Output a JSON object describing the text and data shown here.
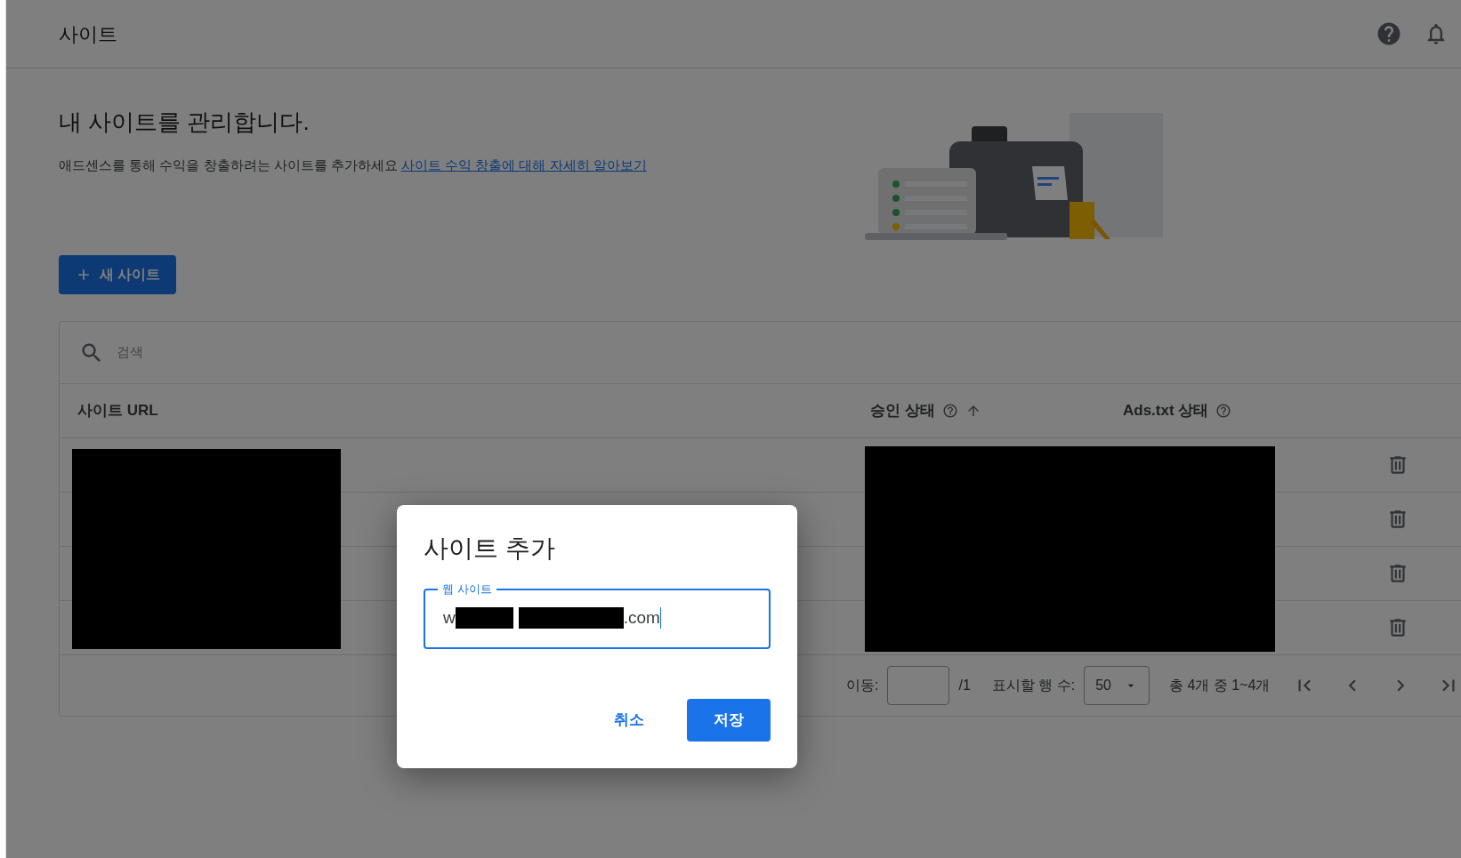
{
  "header": {
    "title": "사이트"
  },
  "intro": {
    "heading": "내 사이트를 관리합니다.",
    "description": "애드센스를 통해 수익을 창출하려는 사이트를 추가하세요",
    "link": "사이트 수익 창출에 대해 자세히 알아보기"
  },
  "new_site_button": {
    "label": "새 사이트"
  },
  "search": {
    "placeholder": "검색"
  },
  "table": {
    "columns": [
      {
        "label": "사이트 URL",
        "help": false,
        "sorted": false
      },
      {
        "label": "승인 상태",
        "help": true,
        "sorted": true
      },
      {
        "label": "Ads.txt 상태",
        "help": true,
        "sorted": false
      }
    ],
    "rows": [
      {
        "deletable": true
      },
      {
        "deletable": true
      },
      {
        "deletable": true
      },
      {
        "deletable": true
      }
    ]
  },
  "pagination": {
    "go_to_label": "이동:",
    "page_total": "/1",
    "rows_per_page_label": "표시할 행 수:",
    "rows_per_page": "50",
    "range": "총 4개 중 1~4개"
  },
  "dialog": {
    "title": "사이트 추가",
    "field": {
      "label": "웹 사이트",
      "value_start": "w",
      "value_end": ".com",
      "focused": true
    },
    "buttons": [
      {
        "label": "취소",
        "kind": "text"
      },
      {
        "label": "저장",
        "kind": "primary"
      }
    ]
  }
}
